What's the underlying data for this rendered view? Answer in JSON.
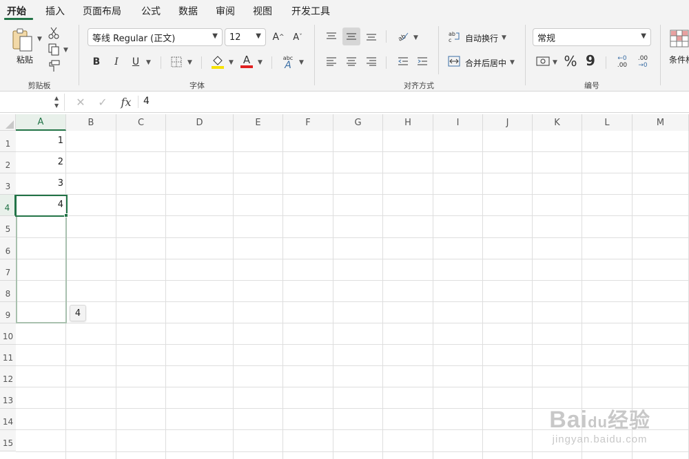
{
  "tabs": [
    {
      "label": "开始",
      "active": true
    },
    {
      "label": "插入",
      "active": false
    },
    {
      "label": "页面布局",
      "active": false
    },
    {
      "label": "公式",
      "active": false
    },
    {
      "label": "数据",
      "active": false
    },
    {
      "label": "审阅",
      "active": false
    },
    {
      "label": "视图",
      "active": false
    },
    {
      "label": "开发工具",
      "active": false
    }
  ],
  "ribbon": {
    "clipboard": {
      "paste_label": "粘贴",
      "group_label": "剪贴板"
    },
    "font": {
      "font_name": "等线 Regular (正文)",
      "font_size": "12",
      "group_label": "字体",
      "bold": "B",
      "italic": "I",
      "underline": "U",
      "grow": "A",
      "shrink": "A",
      "font_color_letter": "A",
      "phonetic_top": "abc",
      "phonetic_letter": "A"
    },
    "alignment": {
      "wrap_text": "自动换行",
      "merge_center": "合并后居中",
      "group_label": "对齐方式"
    },
    "number": {
      "format": "常规",
      "percent": "%",
      "comma": "9",
      "inc_top": "←0",
      "inc_bottom": ".00",
      "dec_top": ".00",
      "dec_bottom": "→0",
      "group_label": "编号"
    },
    "styles": {
      "conditional_format": "条件格式"
    }
  },
  "formula_bar": {
    "content": "4",
    "fx": "fx"
  },
  "columns": [
    "A",
    "B",
    "C",
    "D",
    "E",
    "F",
    "G",
    "H",
    "I",
    "J",
    "K",
    "L",
    "M"
  ],
  "rows": [
    "1",
    "2",
    "3",
    "4",
    "5",
    "6",
    "7",
    "8",
    "9",
    "10",
    "11",
    "12",
    "13",
    "14",
    "15"
  ],
  "cells": {
    "A1": "1",
    "A2": "2",
    "A3": "3",
    "A4": "4"
  },
  "fill_tooltip": "4",
  "watermark": {
    "line1": "Bai",
    "paw": "du",
    "cn": "经验",
    "line2": "jingyan.baidu.com"
  },
  "colors": {
    "accent": "#217346",
    "highlight": "#f6e200",
    "font_red": "#e02020"
  }
}
